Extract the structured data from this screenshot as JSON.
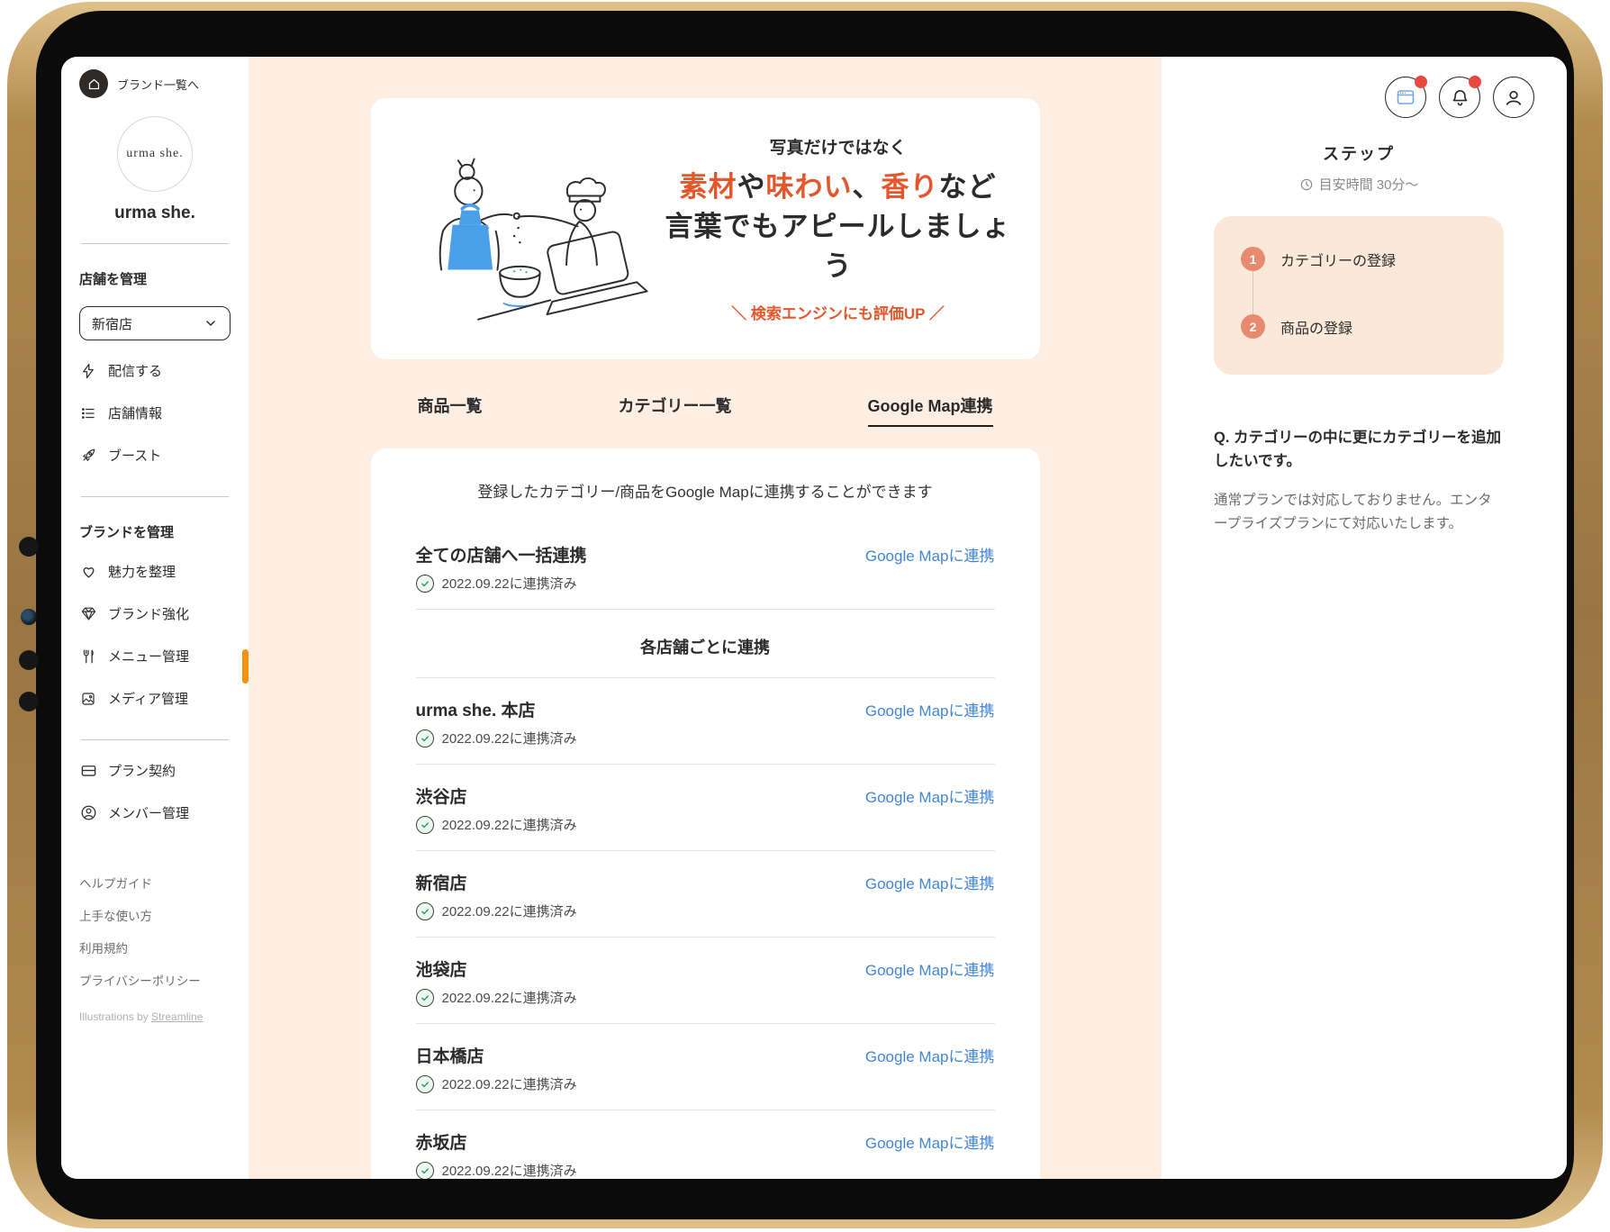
{
  "colors": {
    "accent_orange": "#e2572b",
    "link_blue": "#4285d6",
    "step_coral": "#e78a70",
    "cream": "#fceee3",
    "steps_card": "#fae8d9",
    "badge_red": "#e8493f",
    "check_green": "#2fa06a",
    "indicator_orange": "#f5920f",
    "apron_blue": "#4aa0e8"
  },
  "topbar": {
    "icons": [
      {
        "name": "browser-icon",
        "has_badge": true
      },
      {
        "name": "bell-icon",
        "has_badge": true
      },
      {
        "name": "avatar-icon",
        "has_badge": false
      }
    ]
  },
  "sidebar": {
    "back_label": "ブランド一覧へ",
    "logo_text": "urma she.",
    "brand_name": "urma she.",
    "store_section_label": "店舗を管理",
    "store_selector_value": "新宿店",
    "store_menu": [
      {
        "label": "配信する",
        "icon": "lightning-icon"
      },
      {
        "label": "店舗情報",
        "icon": "list-icon"
      },
      {
        "label": "ブースト",
        "icon": "rocket-icon"
      }
    ],
    "brand_section_label": "ブランドを管理",
    "brand_menu": [
      {
        "label": "魅力を整理",
        "icon": "heart-icon"
      },
      {
        "label": "ブランド強化",
        "icon": "gem-icon"
      },
      {
        "label": "メニュー管理",
        "icon": "utensils-icon",
        "active": true
      },
      {
        "label": "メディア管理",
        "icon": "media-icon"
      }
    ],
    "account_menu": [
      {
        "label": "プラン契約",
        "icon": "card-icon"
      },
      {
        "label": "メンバー管理",
        "icon": "member-icon"
      }
    ],
    "footer_links": [
      "ヘルプガイド",
      "上手な使い方",
      "利用規約",
      "プライバシーポリシー"
    ],
    "credit_prefix": "Illustrations by ",
    "credit_link_label": "Streamline"
  },
  "banner": {
    "kicker": "写真だけではなく",
    "headline_segments": [
      {
        "text": "素材",
        "accent": true
      },
      {
        "text": "や",
        "accent": false
      },
      {
        "text": "味わい",
        "accent": true
      },
      {
        "text": "、",
        "accent": false
      },
      {
        "text": "香り",
        "accent": true
      },
      {
        "text": "など",
        "accent": false
      }
    ],
    "headline_line2": "言葉でもアピールしましょう",
    "tagline": "＼ 検索エンジンにも評価UP ／"
  },
  "tabs": [
    {
      "label": "商品一覧",
      "active": false
    },
    {
      "label": "カテゴリー一覧",
      "active": false
    },
    {
      "label": "Google Map連携",
      "active": true
    }
  ],
  "map_panel": {
    "description": "登録したカテゴリー/商品をGoogle Mapに連携することができます",
    "bulk_row": {
      "title": "全ての店舗へ一括連携",
      "link_label": "Google Mapに連携",
      "status": "2022.09.22に連携済み"
    },
    "section_header": "各店舗ごとに連携",
    "stores": [
      {
        "name": "urma she. 本店",
        "link_label": "Google Mapに連携",
        "status": "2022.09.22に連携済み"
      },
      {
        "name": "渋谷店",
        "link_label": "Google Mapに連携",
        "status": "2022.09.22に連携済み"
      },
      {
        "name": "新宿店",
        "link_label": "Google Mapに連携",
        "status": "2022.09.22に連携済み"
      },
      {
        "name": "池袋店",
        "link_label": "Google Mapに連携",
        "status": "2022.09.22に連携済み"
      },
      {
        "name": "日本橋店",
        "link_label": "Google Mapに連携",
        "status": "2022.09.22に連携済み"
      },
      {
        "name": "赤坂店",
        "link_label": "Google Mapに連携",
        "status": "2022.09.22に連携済み"
      }
    ]
  },
  "right_panel": {
    "title": "ステップ",
    "time_estimate": "目安時間 30分〜",
    "steps": [
      {
        "num": "1",
        "label": "カテゴリーの登録"
      },
      {
        "num": "2",
        "label": "商品の登録"
      }
    ],
    "question": "Q. カテゴリーの中に更にカテゴリーを追加したいです。",
    "answer": "通常プランでは対応しておりません。エンタープライズプランにて対応いたします。"
  }
}
